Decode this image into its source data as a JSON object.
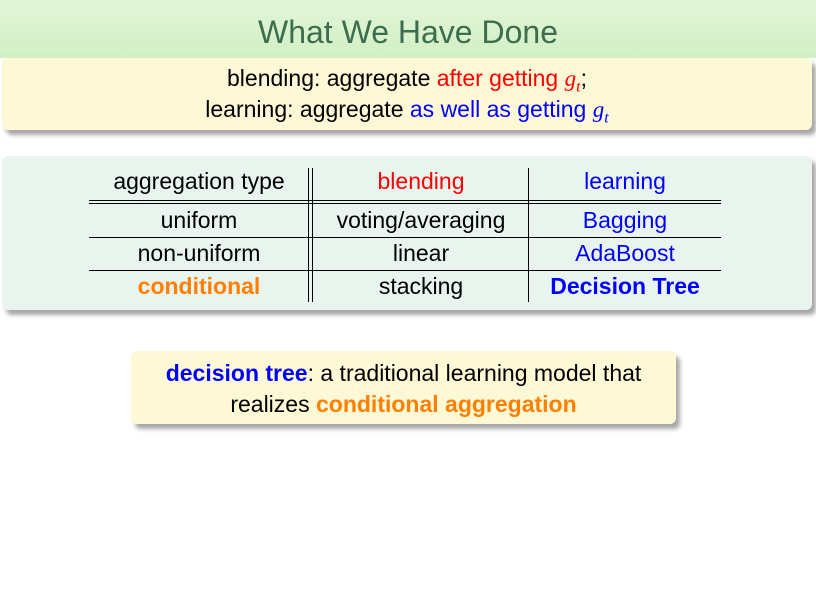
{
  "title": "What We Have Done",
  "intro": {
    "line1": {
      "prefix": "blending: aggregate ",
      "highlight": "after getting ",
      "math": "g",
      "sub": "t",
      "suffix": ";"
    },
    "line2": {
      "prefix": "learning: aggregate ",
      "highlight": "as well as getting ",
      "math": "g",
      "sub": "t"
    }
  },
  "table": {
    "headers": [
      "aggregation type",
      "blending",
      "learning"
    ],
    "rows": [
      [
        "uniform",
        "voting/averaging",
        "Bagging"
      ],
      [
        "non-uniform",
        "linear",
        "AdaBoost"
      ],
      [
        "conditional",
        "stacking",
        "Decision Tree"
      ]
    ]
  },
  "conclusion": {
    "term": "decision tree",
    "rest1": ": a traditional learning model that",
    "rest2_prefix": "realizes ",
    "rest2_highlight": "conditional aggregation"
  },
  "colors": {
    "title": "#3c6e4e",
    "blending": "#ff0000",
    "learning": "#0000ff",
    "conditional": "#ff7f00",
    "yellow_box": "#fdf8d6",
    "green_box": "#e9f4ef"
  }
}
